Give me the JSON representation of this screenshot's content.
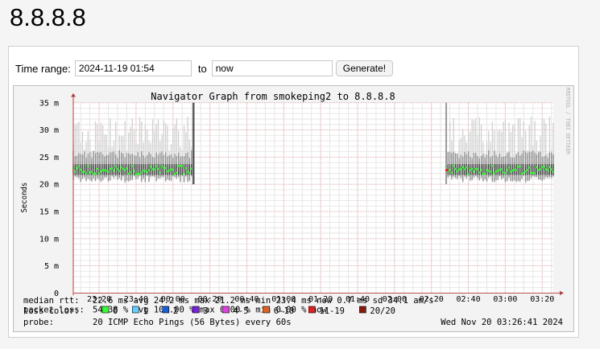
{
  "page": {
    "title": "8.8.8.8"
  },
  "controls": {
    "time_range_label": "Time range:",
    "start_value": "2024-11-19 01:54",
    "to_label": "to",
    "end_value": "now",
    "generate_label": "Generate!"
  },
  "chart_data": {
    "type": "line",
    "title": "Navigator Graph from smokeping2 to 8.8.8.8",
    "ylabel": "Seconds",
    "watermark": "RRDTOOL / TOBI OETIKER",
    "ylim": [
      0,
      35
    ],
    "yticks": [
      0,
      5,
      10,
      15,
      20,
      25,
      30,
      35
    ],
    "ytick_labels": [
      "0",
      "5 m",
      "10 m",
      "15 m",
      "20 m",
      "25 m",
      "30 m",
      "35 m"
    ],
    "x_range": [
      "2024-11-19 23:06",
      "2024-11-20 03:26"
    ],
    "xticks": [
      "23:20",
      "23:40",
      "00:00",
      "00:20",
      "00:40",
      "01:00",
      "01:20",
      "01:40",
      "02:00",
      "02:20",
      "02:40",
      "03:00",
      "03:20"
    ],
    "segments": [
      {
        "start": "23:06",
        "end": "00:11",
        "median_ms": 22.6
      },
      {
        "start": "02:28",
        "end": "03:26",
        "median_ms": 22.6
      }
    ],
    "outage": {
      "start": "00:11",
      "end": "02:28"
    },
    "stats": [
      {
        "label": "median rtt:",
        "text": "22.6 ms avg   24.2 ms max   21.2 ms min   23.4 ms now   0.7 ms sd   34.1    am/s"
      },
      {
        "label": "packet loss:",
        "text": "54.38 % avg   100.00 % max   0.00 % min   0.00 % now"
      }
    ],
    "loss_color_label": "loss color:",
    "loss_colors": [
      {
        "label": "0",
        "color": "#33ff33"
      },
      {
        "label": "1",
        "color": "#66ccff"
      },
      {
        "label": "2",
        "color": "#1b5fd6"
      },
      {
        "label": "3",
        "color": "#7a1fe0"
      },
      {
        "label": "4-5",
        "color": "#e040e0"
      },
      {
        "label": "6-10",
        "color": "#e06020"
      },
      {
        "label": "11-19",
        "color": "#e02020"
      },
      {
        "label": "20/20",
        "color": "#8a1a0e"
      }
    ],
    "probe_label": "probe:",
    "probe_text": "20 ICMP Echo Pings (56 Bytes) every 60s",
    "timestamp": "Wed Nov 20 03:26:41 2024"
  }
}
